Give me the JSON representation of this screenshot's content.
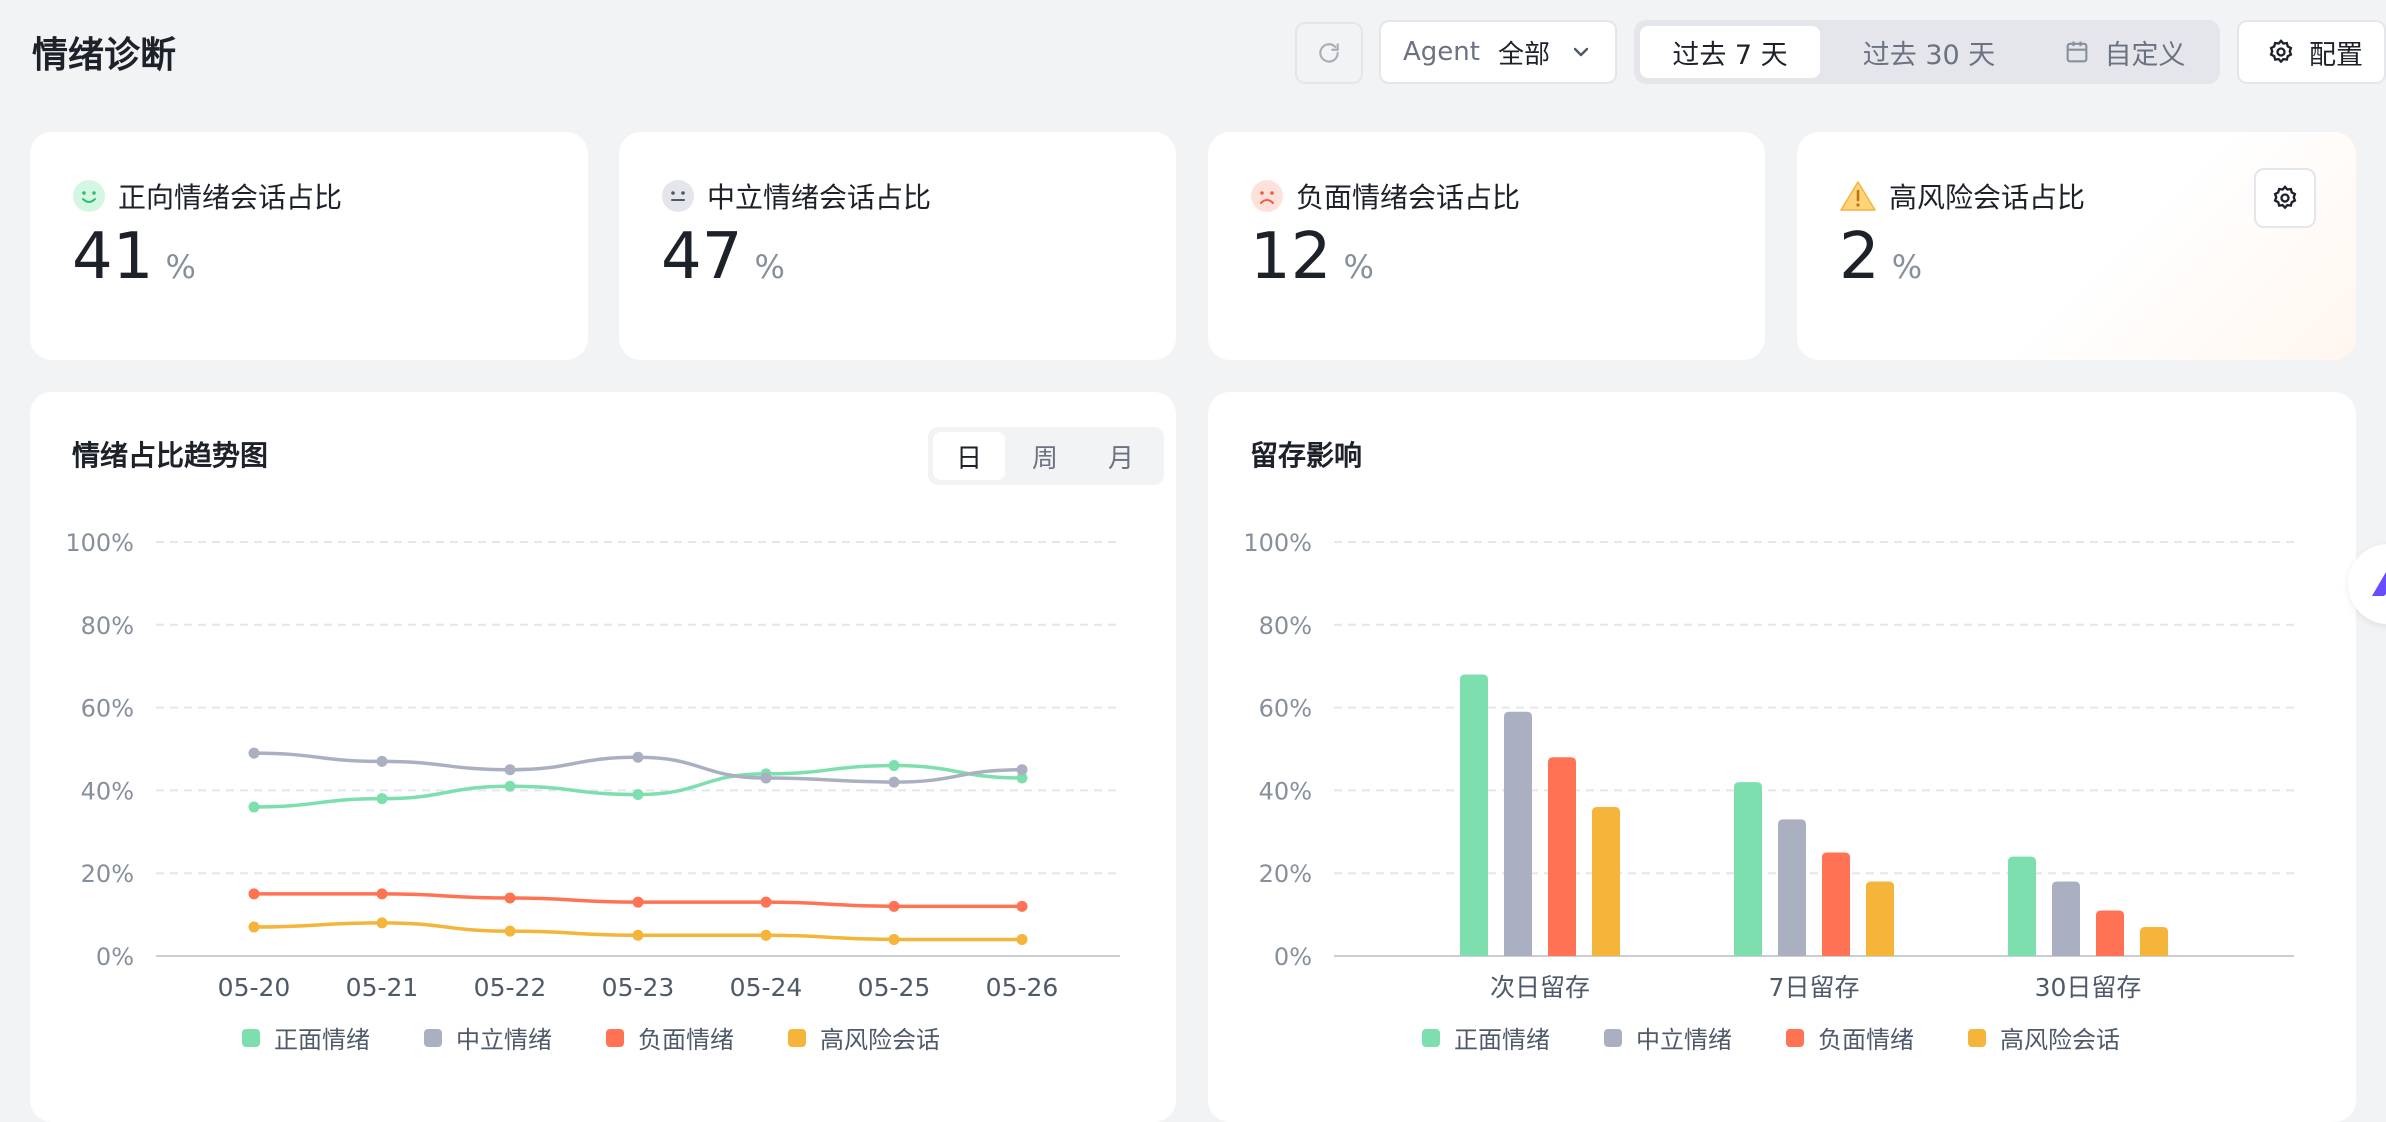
{
  "header": {
    "title": "情绪诊断",
    "agent_label": "Agent",
    "agent_value": "全部",
    "ranges": [
      "过去 7 天",
      "过去 30 天",
      "自定义"
    ],
    "active_range": "过去 7 天",
    "config_label": "配置"
  },
  "stats": [
    {
      "title": "正向情绪会话占比",
      "value": "41",
      "unit": "%",
      "icon": "smile-icon"
    },
    {
      "title": "中立情绪会话占比",
      "value": "47",
      "unit": "%",
      "icon": "neutral-face-icon"
    },
    {
      "title": "负面情绪会话占比",
      "value": "12",
      "unit": "%",
      "icon": "frown-icon"
    },
    {
      "title": "高风险会话占比",
      "value": "2",
      "unit": "%",
      "icon": "warning-icon"
    }
  ],
  "trend": {
    "title": "情绪占比趋势图",
    "granularity": [
      "日",
      "周",
      "月"
    ],
    "active_granularity": "日"
  },
  "retention": {
    "title": "留存影响"
  },
  "colors": {
    "positive": "#7ddfad",
    "neutral": "#aab0c2",
    "negative": "#ff7354",
    "risk": "#f4b53a"
  },
  "chart_data": [
    {
      "type": "line",
      "title": "情绪占比趋势图",
      "x": [
        "05-20",
        "05-21",
        "05-22",
        "05-23",
        "05-24",
        "05-25",
        "05-26"
      ],
      "ylim": [
        0,
        100
      ],
      "yticks": [
        "0%",
        "20%",
        "40%",
        "60%",
        "80%",
        "100%"
      ],
      "grid": true,
      "legend": "bottom",
      "series": [
        {
          "name": "正面情绪",
          "color": "#7ddfad",
          "values": [
            36,
            38,
            41,
            39,
            44,
            46,
            43
          ]
        },
        {
          "name": "中立情绪",
          "color": "#aab0c2",
          "values": [
            49,
            47,
            45,
            48,
            43,
            42,
            45
          ]
        },
        {
          "name": "负面情绪",
          "color": "#ff7354",
          "values": [
            15,
            15,
            14,
            13,
            13,
            12,
            12
          ]
        },
        {
          "name": "高风险会话",
          "color": "#f4b53a",
          "values": [
            7,
            8,
            6,
            5,
            5,
            4,
            4
          ]
        }
      ]
    },
    {
      "type": "bar",
      "title": "留存影响",
      "categories": [
        "次日留存",
        "7日留存",
        "30日留存"
      ],
      "ylim": [
        0,
        100
      ],
      "yticks": [
        "0%",
        "20%",
        "40%",
        "60%",
        "80%",
        "100%"
      ],
      "grid": true,
      "legend": "bottom",
      "series": [
        {
          "name": "正面情绪",
          "color": "#7ddfad",
          "values": [
            68,
            42,
            24
          ]
        },
        {
          "name": "中立情绪",
          "color": "#aab0c2",
          "values": [
            59,
            33,
            18
          ]
        },
        {
          "name": "负面情绪",
          "color": "#ff7354",
          "values": [
            48,
            25,
            11
          ]
        },
        {
          "name": "高风险会话",
          "color": "#f4b53a",
          "values": [
            36,
            18,
            7
          ]
        }
      ]
    }
  ]
}
